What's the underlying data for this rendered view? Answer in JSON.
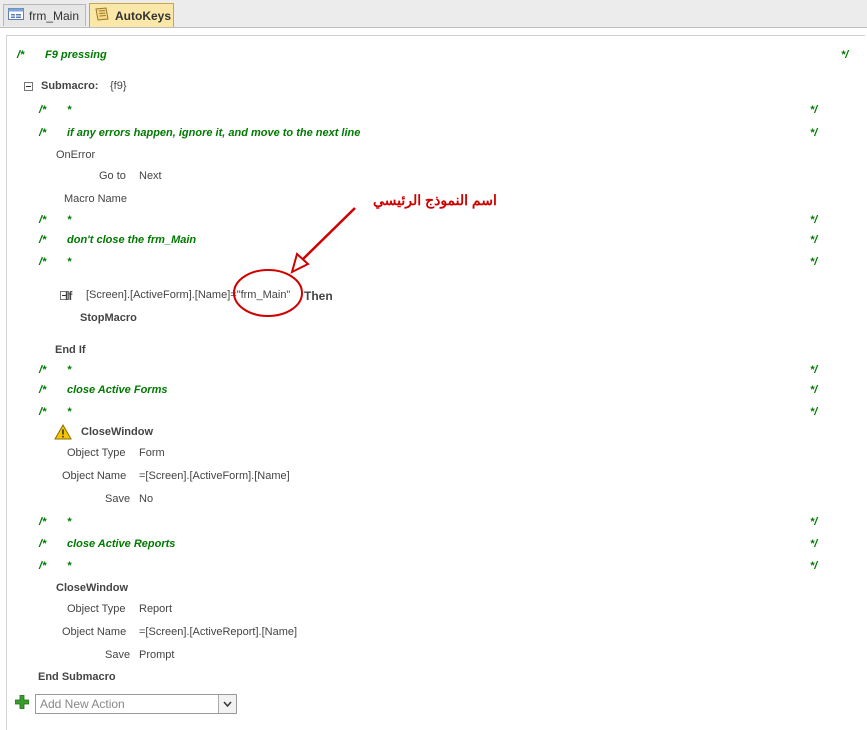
{
  "tabs": [
    {
      "label": "frm_Main",
      "icon": "form-icon"
    },
    {
      "label": "AutoKeys",
      "icon": "macro-icon"
    }
  ],
  "macro": {
    "header_comment": "F9 pressing",
    "comment_open": "/*",
    "comment_close": "*/",
    "star": "*",
    "submacro_label": "Submacro:",
    "submacro_name": "{f9}",
    "comment_ignore": "if any errors happen, ignore it, and move to the next line",
    "onerror": {
      "action": "OnError",
      "goto_label": "Go to",
      "goto_value": "Next",
      "macroname_label": "Macro Name"
    },
    "comment_dont_close": "don't close the frm_Main",
    "if_block": {
      "if_kw": "If",
      "condition_prefix": "[Screen].[ActiveForm].[Name]=",
      "condition_value": "\"frm_Main\"",
      "then_kw": "Then",
      "action": "StopMacro",
      "end_if": "End If"
    },
    "comment_close_forms": "close Active Forms",
    "closewindow_forms": {
      "action": "CloseWindow",
      "objtype_label": "Object Type",
      "objtype_value": "Form",
      "objname_label": "Object Name",
      "objname_value": "=[Screen].[ActiveForm].[Name]",
      "save_label": "Save",
      "save_value": "No"
    },
    "comment_close_reports": "close Active Reports",
    "closewindow_reports": {
      "action": "CloseWindow",
      "objtype_label": "Object Type",
      "objtype_value": "Report",
      "objname_label": "Object Name",
      "objname_value": "=[Screen].[ActiveReport].[Name]",
      "save_label": "Save",
      "save_value": "Prompt"
    },
    "end_submacro": "End Submacro",
    "add_new_action_placeholder": "Add New Action"
  },
  "annotation": {
    "text": "اسم النموذج الرئيسي",
    "color": "#d00000"
  },
  "colors": {
    "comment": "#007a00",
    "active_tab": "#fbe7a8",
    "warning": "#f5c400"
  }
}
